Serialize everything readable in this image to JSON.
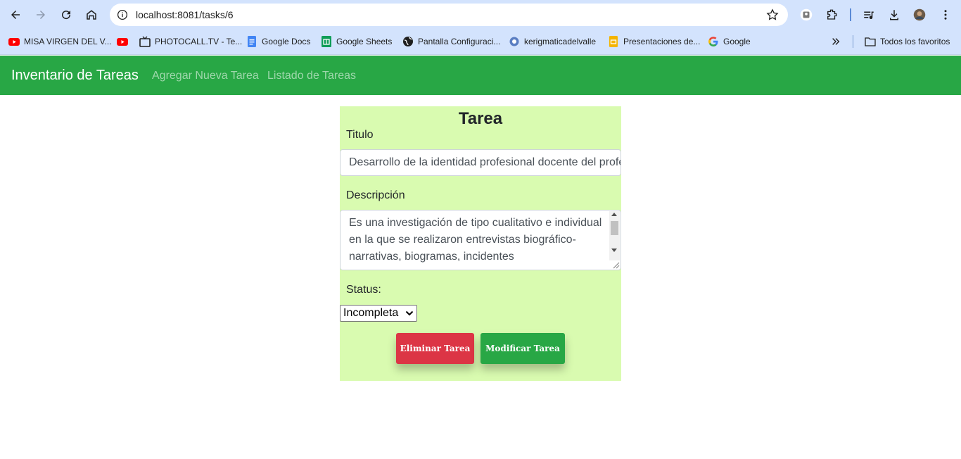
{
  "browser": {
    "url": "localhost:8081/tasks/6",
    "bookmarks": [
      {
        "label": "MISA VIRGEN DEL V...",
        "icon": "youtube-icon"
      },
      {
        "label": "",
        "icon": "youtube-icon"
      },
      {
        "label": "PHOTOCALL.TV - Te...",
        "icon": "tv-icon"
      },
      {
        "label": "Google Docs",
        "icon": "google-docs-icon"
      },
      {
        "label": "Google Sheets",
        "icon": "google-sheets-icon"
      },
      {
        "label": "Pantalla Configuraci...",
        "icon": "globe-icon"
      },
      {
        "label": "kerigmaticadelvalle",
        "icon": "site-icon"
      },
      {
        "label": "Presentaciones de...",
        "icon": "google-slides-icon"
      },
      {
        "label": "Google",
        "icon": "google-icon"
      }
    ],
    "all_bookmarks": "Todos los favoritos"
  },
  "navbar": {
    "brand": "Inventario de Tareas",
    "links": [
      "Agregar Nueva Tarea",
      "Listado de Tareas"
    ]
  },
  "form": {
    "title": "Tarea",
    "titulo_label": "Titulo",
    "titulo_value": "Desarrollo de la identidad profesional docente del profesorado",
    "descripcion_label": "Descripción",
    "descripcion_value": " Es una investigación de tipo cualitativo e individual en la que se realizaron entrevistas biográfico-narrativas, biogramas, incidentes",
    "status_label": "Status:",
    "status_value": "Incompleta",
    "delete_label": "Eliminar Tarea",
    "modify_label": "Modificar Tarea"
  },
  "colors": {
    "navbar": "#28a745",
    "card": "#d9fbb0",
    "delete": "#dc3545",
    "modify": "#28a745"
  }
}
